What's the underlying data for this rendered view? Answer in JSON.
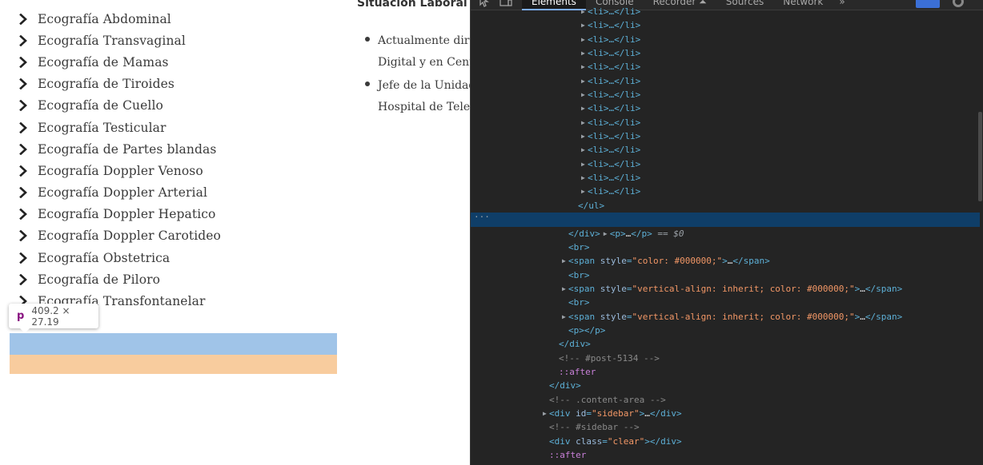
{
  "menu": {
    "items": [
      "Ecografía Abdominal",
      "Ecografía Transvaginal",
      "Ecografía de Mamas",
      "Ecografía de Tiroides",
      "Ecografía de Cuello",
      "Ecografía Testicular",
      "Ecografía de Partes blandas",
      "Ecografía Doppler Venoso",
      "Ecografía Doppler Arterial",
      "Ecografía Doppler Hepatico",
      "Ecografía Doppler Carotideo",
      "Ecografía Obstetrica",
      "Ecografía de Piloro",
      "Ecografía Transfontanelar"
    ]
  },
  "article": {
    "title": "Situación Laboral Act",
    "bullets": [
      [
        "Actualmente dirig",
        "Digital y en Centr"
      ],
      [
        "Jefe de la Unidad",
        "Hospital de Teleso"
      ]
    ]
  },
  "inspect_tooltip": {
    "tag": "p",
    "size": "409.2 × 27.19"
  },
  "highlight_colors": {
    "content": "#a0c4e8",
    "margin": "#f8cc9e"
  },
  "devtools": {
    "tabs": [
      "Elements",
      "Console",
      "Recorder ⏶",
      "Sources",
      "Network"
    ],
    "active_tab": "Elements",
    "more_tabs": "»",
    "accent": "#7cacf8",
    "selected_row_color": "#0f3e68",
    "li_collapsed": "<li>…</li>",
    "lines": {
      "ul_close": "</ul>",
      "p_selected_open": "<p>",
      "p_selected_ellipsis": "…",
      "p_selected_close": "</p>",
      "dollar_zero": "== $0",
      "div_close": "</div>",
      "br": "<br>",
      "span1_style": "color: #000000;",
      "span2_style": "vertical-align: inherit; color: #000000;",
      "span3_style": "vertical-align: inherit; color: #000000;",
      "p_empty": "<p></p>",
      "comment_post": "<!-- #post-5134 -->",
      "after": "::after",
      "comment_content": "<!-- .content-area -->",
      "sidebar_id": "sidebar",
      "comment_sidebar": "<!-- #sidebar -->",
      "clear_class": "clear"
    }
  }
}
